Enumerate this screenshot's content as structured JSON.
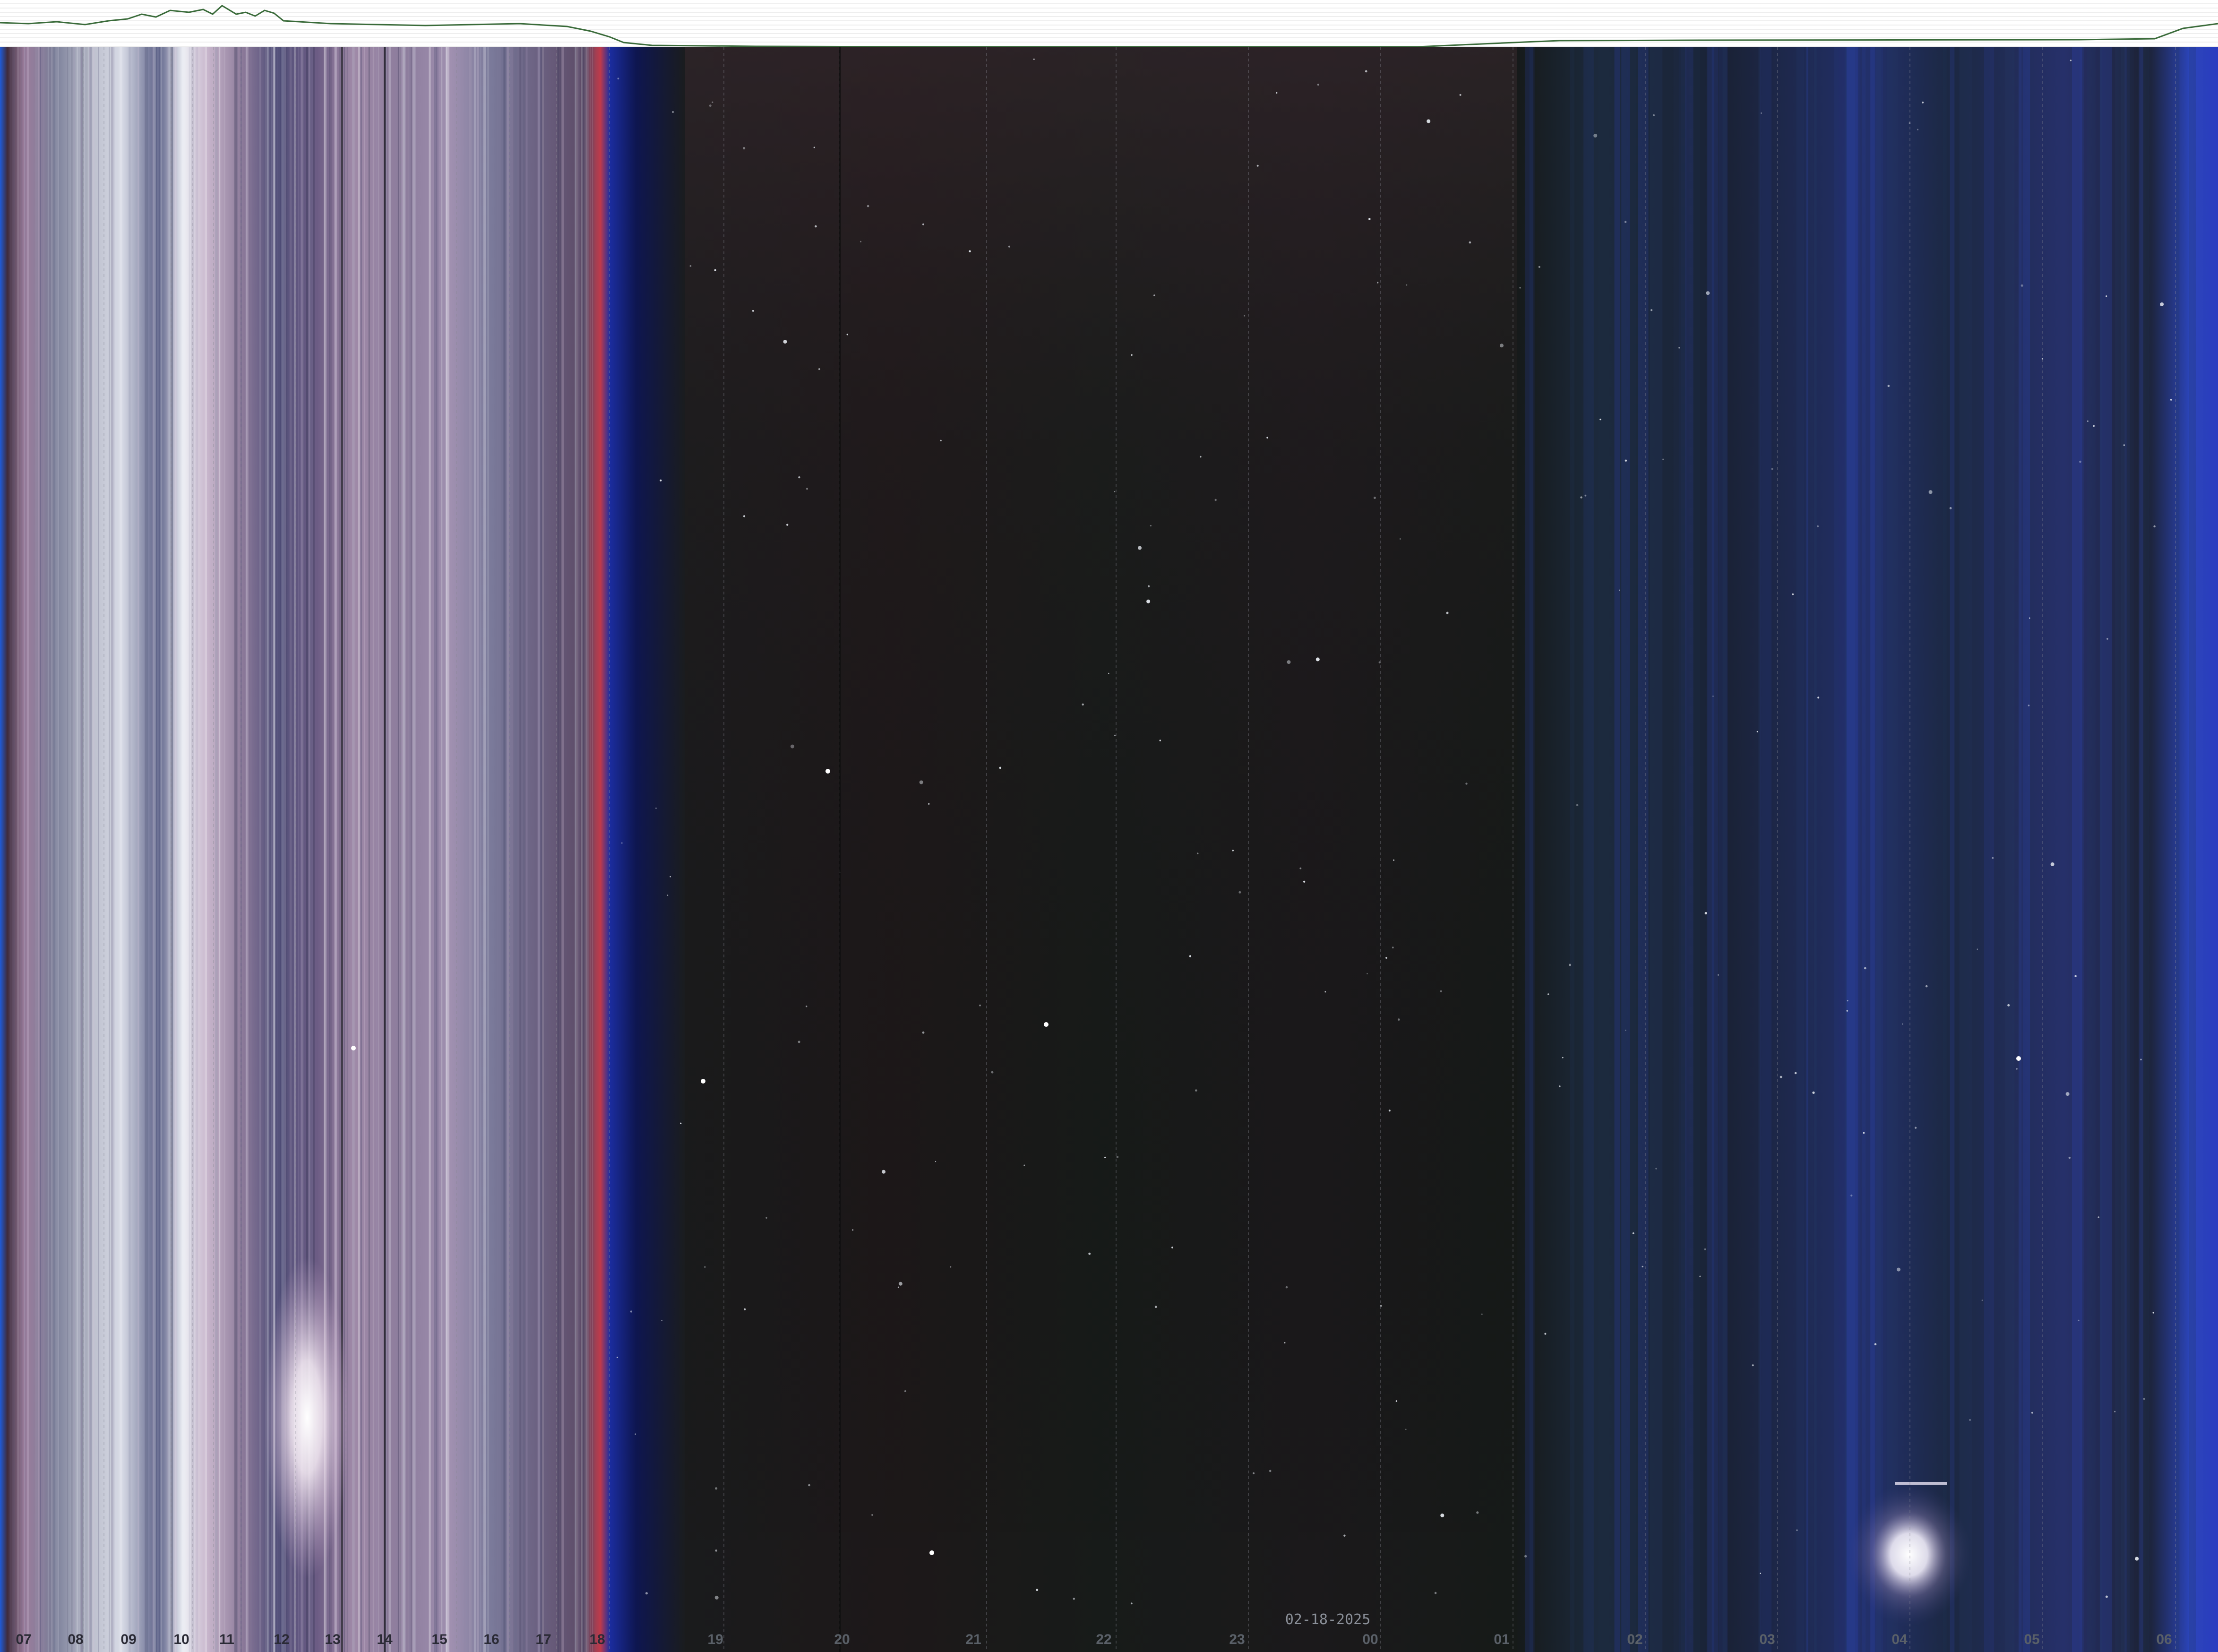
{
  "date": "02-18-2025",
  "hours": [
    "07",
    "08",
    "09",
    "10",
    "11",
    "12",
    "13",
    "14",
    "15",
    "16",
    "17",
    "18",
    "19",
    "20",
    "21",
    "22",
    "23",
    "00",
    "01",
    "02",
    "03",
    "04",
    "05",
    "06"
  ],
  "colors": {
    "day_label": "#2a2a35",
    "night_label": "#5a6068",
    "date_label": "#8a8f98",
    "night_sky": "#161a18",
    "twilight_blue": "#1f3fc4",
    "day_pink": "#a58aa6",
    "day_white": "#eef0f4",
    "graph_bg": "#ffffff",
    "graph_grid": "#dcdcdc",
    "graph_line": "#3a6b3a"
  }
}
